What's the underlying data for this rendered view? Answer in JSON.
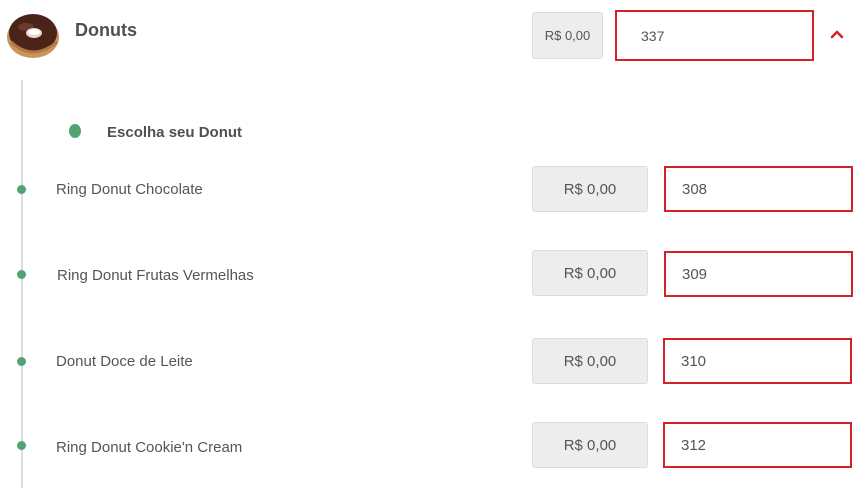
{
  "category": {
    "title": "Donuts",
    "price": "R$ 0,00",
    "code": "337",
    "image": "donut-image",
    "toggle_icon": "chevron-up-icon"
  },
  "group": {
    "label": "Escolha seu Donut"
  },
  "items": [
    {
      "name": "Ring Donut Chocolate",
      "price": "R$ 0,00",
      "code": "308"
    },
    {
      "name": "Ring Donut Frutas Vermelhas",
      "price": "R$ 0,00",
      "code": "309"
    },
    {
      "name": "Donut Doce de Leite",
      "price": "R$ 0,00",
      "code": "310"
    },
    {
      "name": "Ring Donut Cookie'n Cream",
      "price": "R$ 0,00",
      "code": "312"
    }
  ],
  "colors": {
    "accent_red": "#d3222a",
    "timeline_green": "#52a371",
    "price_bg": "#ededed"
  }
}
